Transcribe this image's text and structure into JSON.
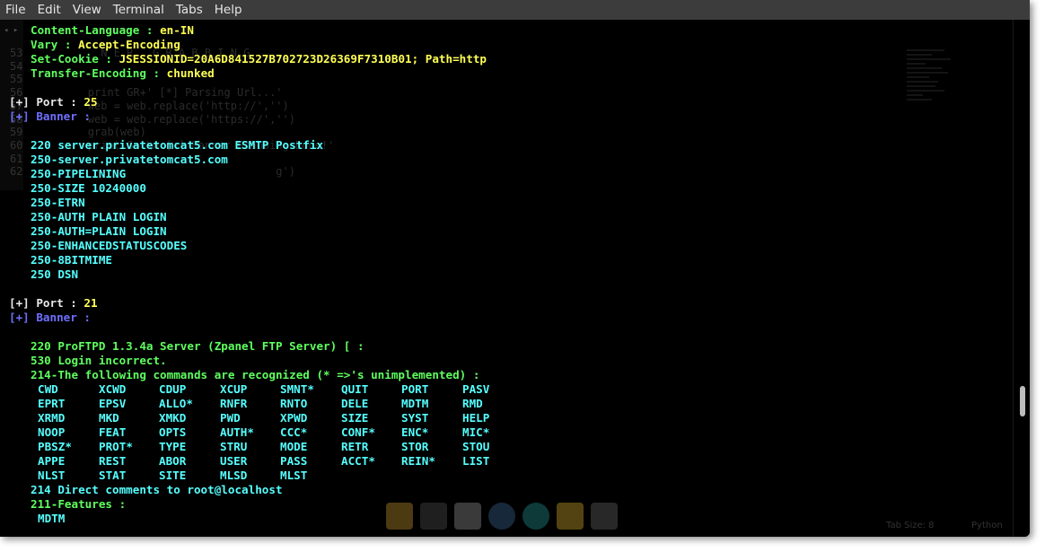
{
  "menu": [
    "File",
    "Edit",
    "View",
    "Terminal",
    "Tabs",
    "Help"
  ],
  "headers": [
    {
      "key": "Content-Language",
      "value": "en-IN"
    },
    {
      "key": "Vary",
      "value": "Accept-Encoding"
    },
    {
      "key": "Set-Cookie",
      "value": "JSESSIONID=20A6D841527B702723D26369F7310B01; Path=http"
    },
    {
      "key": "Transfer-Encoding",
      "value": "chunked"
    }
  ],
  "port1": {
    "label": "[+] Port :",
    "number": "25",
    "banner": "[+] Banner :"
  },
  "smtp_lines": [
    "220 server.privatetomcat5.com ESMTP Postfix",
    "250-server.privatetomcat5.com",
    "250-PIPELINING",
    "250-SIZE 10240000",
    "250-ETRN",
    "250-AUTH PLAIN LOGIN",
    "250-AUTH=PLAIN LOGIN",
    "250-ENHANCEDSTATUSCODES",
    "250-8BITMIME",
    "250 DSN"
  ],
  "port2": {
    "label": "[+] Port :",
    "number": "21",
    "banner": "[+] Banner :"
  },
  "ftp_lines": [
    "220 ProFTPD 1.3.4a Server (Zpanel FTP Server) [ :",
    "530 Login incorrect.",
    "214-The following commands are recognized (* =>'s unimplemented) :"
  ],
  "ftp_commands": [
    [
      "CWD",
      "XCWD",
      "CDUP",
      "XCUP",
      "SMNT*",
      "QUIT",
      "PORT",
      "PASV"
    ],
    [
      "EPRT",
      "EPSV",
      "ALLO*",
      "RNFR",
      "RNTO",
      "DELE",
      "MDTM",
      "RMD"
    ],
    [
      "XRMD",
      "MKD",
      "XMKD",
      "PWD",
      "XPWD",
      "SIZE",
      "SYST",
      "HELP"
    ],
    [
      "NOOP",
      "FEAT",
      "OPTS",
      "AUTH*",
      "CCC*",
      "CONF*",
      "ENC*",
      "MIC*"
    ],
    [
      "PBSZ*",
      "PROT*",
      "TYPE",
      "STRU",
      "MODE",
      "RETR",
      "STOR",
      "STOU"
    ],
    [
      "APPE",
      "REST",
      "ABOR",
      "USER",
      "PASS",
      "ACCT*",
      "REIN*",
      "LIST"
    ],
    [
      "NLST",
      "STAT",
      "SITE",
      "MLSD",
      "MLST"
    ]
  ],
  "ftp_footer": [
    "214 Direct comments to root@localhost",
    "211-Features :",
    "MDTM"
  ],
  "ghost_code": {
    "line_numbers": [
      "53",
      "54",
      "55",
      "56",
      "57",
      "58",
      "59",
      "60",
      "61",
      "62"
    ],
    "lines": [
      "          N E R   G R A B B I N G",
      "",
      "",
      "        print GR+' [*] Parsing Url...'",
      "        web = web.replace('http://','')",
      "        web = web.replace('https://','')",
      "        grab(web)",
      "        print G+'\\n [+] Banner Grabbing Done!'",
      "",
      "                                     g')"
    ],
    "status_tab": "Tab Size: 8",
    "status_lang": "Python"
  },
  "colors": {
    "menubar_bg": "#3c3c3c",
    "terminal_bg": "#000000",
    "green": "#5fff5f",
    "yellow": "#ffff55",
    "cyan": "#55ffff",
    "blue": "#6f6fff",
    "white": "#e8e8e8"
  }
}
